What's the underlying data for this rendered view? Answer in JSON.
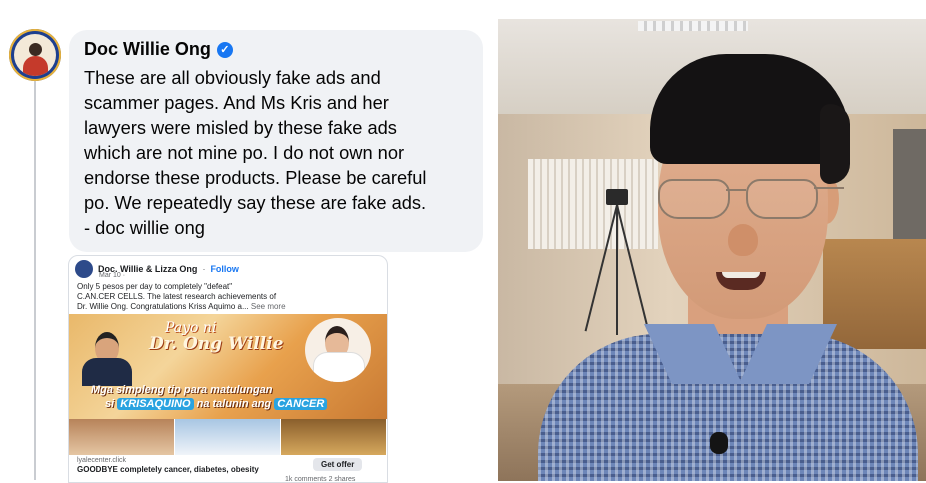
{
  "comment": {
    "author": "Doc Willie Ong",
    "lines": [
      "These are all obviously fake ads and",
      "scammer pages. And Ms Kris and her",
      "lawyers were misled by these fake ads",
      "which are not mine po. I do not own nor",
      "endorse these products. Please be careful",
      "po. We repeatedly say these are fake ads.",
      "- doc willie ong"
    ]
  },
  "embedded_post": {
    "page_name": "Doc. Willie & Lizza Ong",
    "follow_label": "Follow",
    "date": "Mar 10 ·",
    "text_lines": [
      "Only 5 pesos per day to completely \"defeat\"",
      "C.AN.CER CELLS. The latest research achievements of",
      "Dr. Willie Ong. Congratulations Kriss Aquimo a..."
    ],
    "see_more": "See more",
    "banner_title_1": "Payo ni",
    "banner_title_2": "Dr. Ong Willie",
    "banner_caption_1": "Mga simpleng tip para matulungan",
    "banner_caption_2a": "si",
    "banner_caption_2b": "KRISAQUINO",
    "banner_caption_2c": "na talunin ang",
    "banner_caption_2d": "CANCER",
    "link_domain": "lyalecenter.click",
    "link_title": "GOODBYE completely cancer, diabetes, obesity",
    "cta_label": "Get offer",
    "footer": "1k comments  2 shares"
  },
  "colors": {
    "bubble": "#f0f2f5",
    "verified": "#1877f2",
    "link": "#1877f2"
  }
}
